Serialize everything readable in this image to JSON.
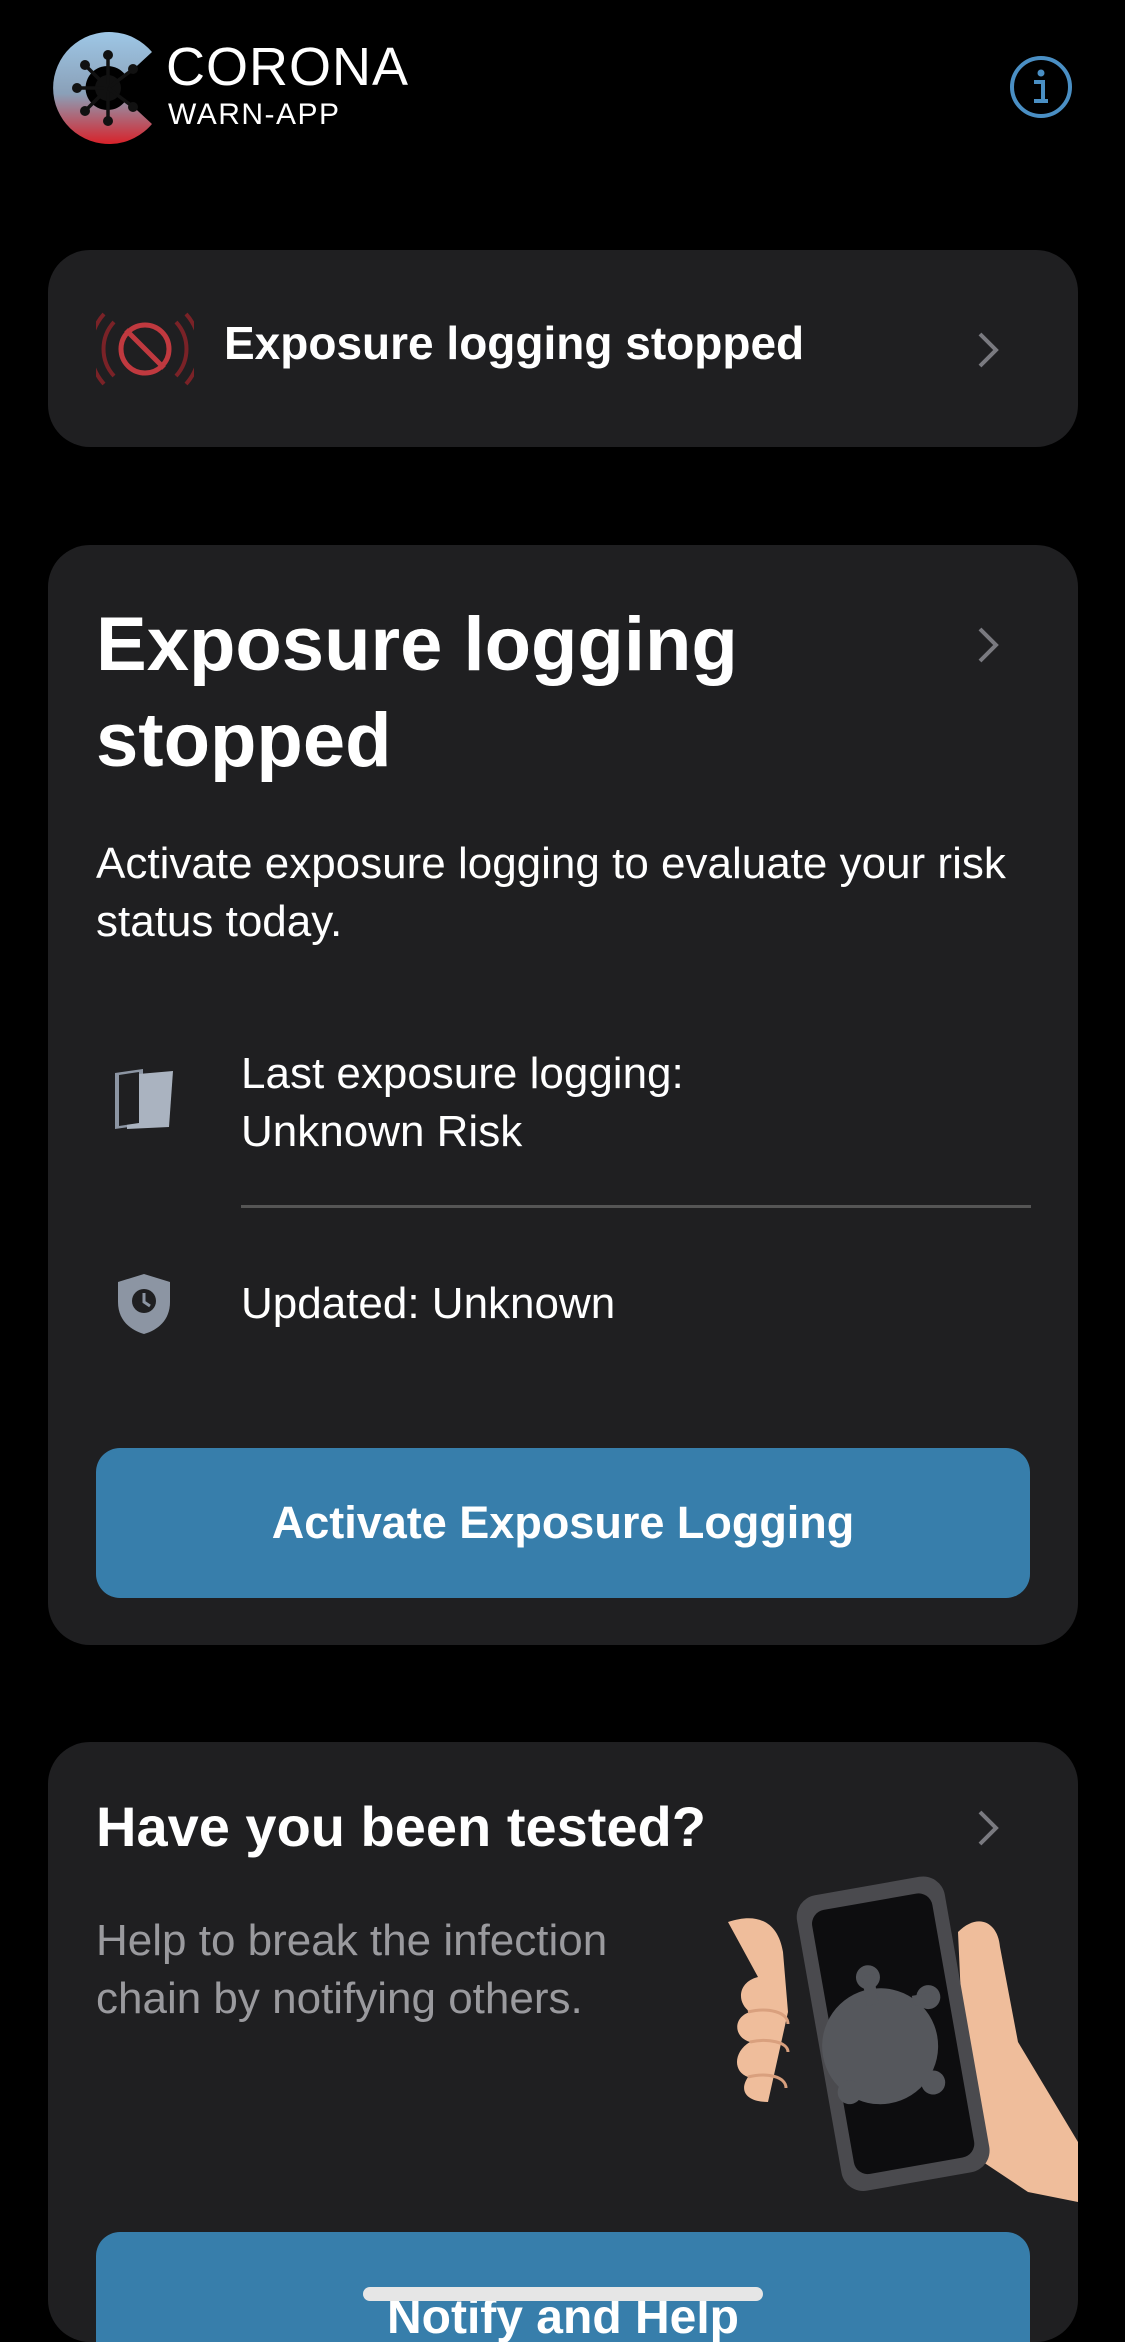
{
  "app": {
    "logo_line1": "CORONA",
    "logo_line2": "WARN-APP"
  },
  "status_card": {
    "label": "Exposure logging stopped",
    "icon": "exposure-off-icon"
  },
  "risk_card": {
    "title": "Exposure logging stopped",
    "description": "Activate exposure logging to evaluate your risk status today.",
    "last_logging": "Last exposure logging: Unknown Risk",
    "updated": "Updated: Unknown",
    "button_label": "Activate Exposure Logging"
  },
  "test_card": {
    "title": "Have you been tested?",
    "description": "Help to break the infection chain by notifying others.",
    "button_label": "Notify and Help"
  },
  "colors": {
    "background": "#000000",
    "card": "#1f1f21",
    "accent": "#377eab",
    "alert_red": "#c0393f"
  }
}
